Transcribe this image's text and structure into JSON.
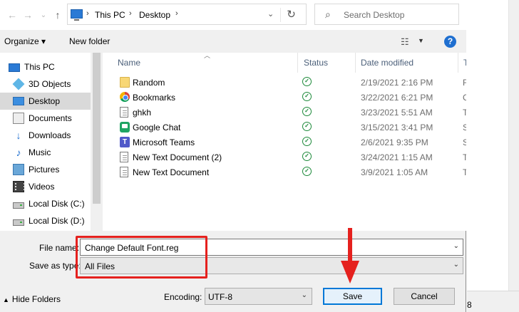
{
  "address_bar": {
    "segments": [
      "This PC",
      "Desktop"
    ],
    "search_placeholder": "Search Desktop"
  },
  "toolbar": {
    "organize_label": "Organize ▾",
    "new_folder_label": "New folder",
    "help_label": "?"
  },
  "nav_pane": {
    "items": [
      {
        "label": "This PC",
        "icon": "this-pc-icon"
      },
      {
        "label": "3D Objects",
        "icon": "3d-objects-icon"
      },
      {
        "label": "Desktop",
        "icon": "desktop-icon",
        "selected": true
      },
      {
        "label": "Documents",
        "icon": "documents-icon"
      },
      {
        "label": "Downloads",
        "icon": "downloads-icon"
      },
      {
        "label": "Music",
        "icon": "music-icon"
      },
      {
        "label": "Pictures",
        "icon": "pictures-icon"
      },
      {
        "label": "Videos",
        "icon": "videos-icon"
      },
      {
        "label": "Local Disk (C:)",
        "icon": "drive-icon"
      },
      {
        "label": "Local Disk (D:)",
        "icon": "drive-icon"
      }
    ]
  },
  "file_list": {
    "columns": {
      "name": "Name",
      "status": "Status",
      "date": "Date modified",
      "type": "T"
    },
    "rows": [
      {
        "name": "Random",
        "date": "2/19/2021 2:16 PM",
        "type": "F",
        "icon": "folder-icon"
      },
      {
        "name": "Bookmarks",
        "date": "3/22/2021 6:21 PM",
        "type": "C",
        "icon": "chrome-icon"
      },
      {
        "name": "ghkh",
        "date": "3/23/2021 5:51 AM",
        "type": "T",
        "icon": "text-document-icon"
      },
      {
        "name": "Google Chat",
        "date": "3/15/2021 3:41 PM",
        "type": "S",
        "icon": "google-chat-icon"
      },
      {
        "name": "Microsoft Teams",
        "date": "2/6/2021 9:35 PM",
        "type": "S",
        "icon": "teams-icon"
      },
      {
        "name": "New Text Document (2)",
        "date": "3/24/2021 1:15 AM",
        "type": "T",
        "icon": "text-document-icon"
      },
      {
        "name": "New Text Document",
        "date": "3/9/2021 1:05 AM",
        "type": "T",
        "icon": "text-document-icon"
      }
    ]
  },
  "save_form": {
    "file_name_label": "File name:",
    "file_name_value": "Change Default Font.reg",
    "save_as_type_label": "Save as type:",
    "save_as_type_value": "All Files",
    "encoding_label": "Encoding:",
    "encoding_value": "UTF-8",
    "hide_folders_label": "Hide Folders",
    "save_label": "Save",
    "cancel_label": "Cancel"
  },
  "background_window": {
    "status_fragment": "8"
  },
  "colors": {
    "annotation_red": "#e5211e",
    "status_green": "#1d8a3a",
    "accent_blue": "#0078d7"
  }
}
